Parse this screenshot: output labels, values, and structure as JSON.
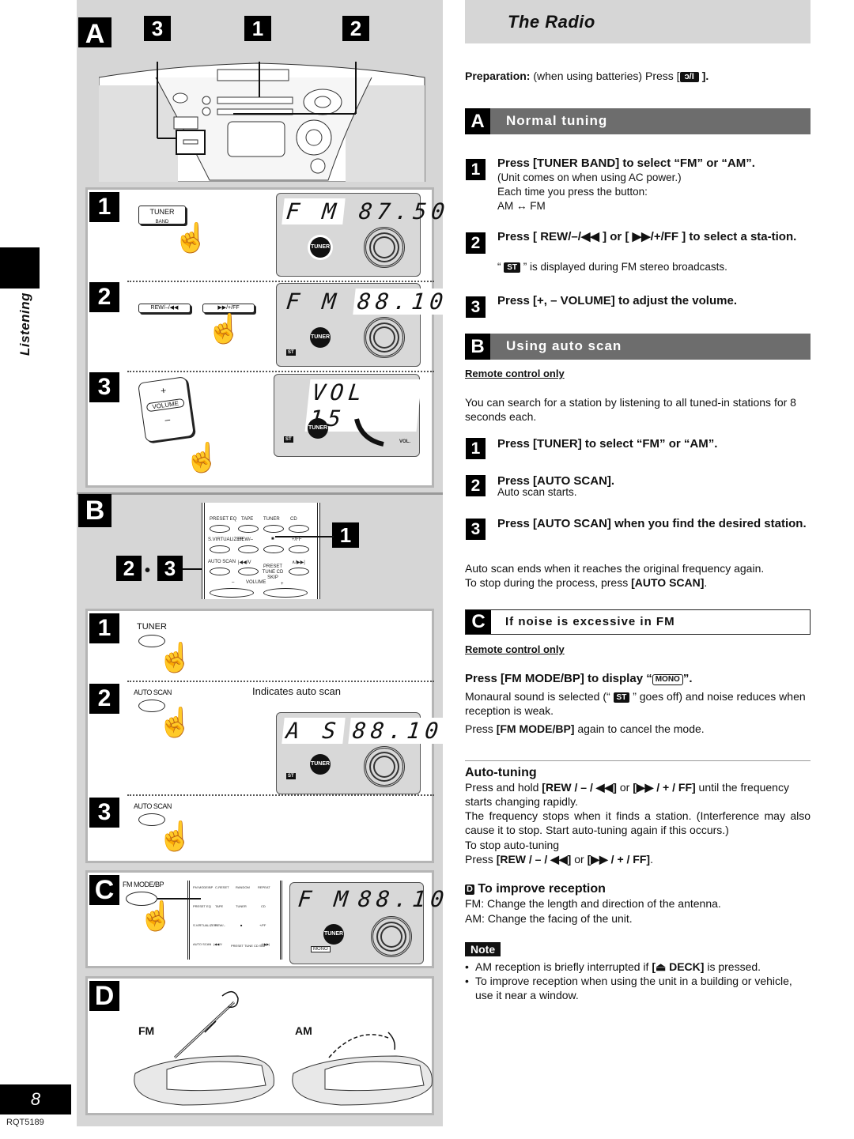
{
  "side_tab": {
    "label": "Listening"
  },
  "footer": {
    "page_number": "8",
    "doc_code": "RQT5189"
  },
  "illustration": {
    "section_a": {
      "letter": "A",
      "callouts": [
        "3",
        "1",
        "2"
      ],
      "steps": [
        {
          "num": "1",
          "button": {
            "label": "TUNER",
            "sublabel": "BAND"
          },
          "display": {
            "band": "F  M",
            "value": "87.50",
            "indicator": "TUNER",
            "st": ""
          }
        },
        {
          "num": "2",
          "buttons": [
            "REW/–/◀◀",
            "▶▶/+/FF"
          ],
          "display": {
            "band": "F  M",
            "value": "88.10",
            "indicator": "TUNER",
            "st": "ST"
          }
        },
        {
          "num": "3",
          "button": {
            "plus": "+",
            "label": "VOLUME",
            "minus": "–"
          },
          "display": {
            "text": "VOL  15",
            "indicator": "TUNER",
            "st": "ST",
            "vol_label": "VOL."
          }
        }
      ]
    },
    "section_b": {
      "letter": "B",
      "callout_right": "1",
      "callout_left": [
        "2",
        "3"
      ],
      "remote_labels": {
        "row1": [
          "PRESET EQ",
          "TAPE",
          "TUNER",
          "CD"
        ],
        "row2": [
          "S.VIRTUALIZER",
          "REW/–",
          "■",
          "+/FF"
        ],
        "row3": [
          "AUTO SCAN",
          "|◀◀/V",
          "PRESET TUNE CD SKIP",
          "∧/▶▶|"
        ],
        "volume": [
          "–",
          "VOLUME",
          "+"
        ]
      },
      "steps": [
        {
          "num": "1",
          "label": "TUNER"
        },
        {
          "num": "2",
          "label": "AUTO SCAN",
          "annotation": "Indicates auto scan",
          "display": {
            "band": "A  S",
            "value": "88.10",
            "indicator": "TUNER",
            "st": "ST"
          }
        },
        {
          "num": "3",
          "label": "AUTO SCAN"
        }
      ]
    },
    "section_c": {
      "letter": "C",
      "button_label": "FM MODE/BP",
      "remote_labels": {
        "row0": [
          "FM MODE/BP",
          "C-RESET",
          "RANDOM",
          "REPEAT"
        ],
        "row1": [
          "PRESET EQ",
          "TAPE",
          "TUNER",
          "CD"
        ],
        "row2": [
          "S.VIRTUALIZER",
          "REW/–",
          "■",
          "+/FF"
        ],
        "row3": [
          "AUTO SCAN",
          "|◀◀/V",
          "PRESET TUNE CD SKIP",
          "∧/▶▶|"
        ]
      },
      "display": {
        "band": "F  M",
        "value": "88.10",
        "indicator": "TUNER",
        "mono": "MONO"
      }
    },
    "section_d": {
      "letter": "D",
      "labels": [
        "FM",
        "AM"
      ]
    }
  },
  "content": {
    "title": "The Radio",
    "preparation": {
      "label": "Preparation:",
      "text": " (when using batteries) Press [",
      "icon": "ↄ/I",
      "end": "]."
    },
    "normal_tuning": {
      "letter": "A",
      "title": "Normal tuning",
      "steps": [
        {
          "num": "1",
          "head": "Press [TUNER BAND] to select “FM” or “AM”.",
          "lines": [
            "(Unit comes on when using AC power.)",
            "Each time you press the button:",
            "AM ↔ FM"
          ]
        },
        {
          "num": "2",
          "head": "Press [ REW/–/◀◀ ] or [ ▶▶/+/FF ] to select a sta-tion.",
          "note_pre": "“ ",
          "note_badge": "ST",
          "note_post": " ” is displayed during FM stereo broadcasts."
        },
        {
          "num": "3",
          "head": "Press [+, – VOLUME] to adjust the volume."
        }
      ]
    },
    "auto_scan": {
      "letter": "B",
      "title": "Using auto scan",
      "remote_only": "Remote control only",
      "intro": "You can search for a station by listening to all tuned-in stations for 8 seconds each.",
      "steps": [
        {
          "num": "1",
          "head": "Press [TUNER] to select “FM” or “AM”."
        },
        {
          "num": "2",
          "head": "Press [AUTO SCAN].",
          "sub": "Auto scan starts."
        },
        {
          "num": "3",
          "head": "Press [AUTO SCAN] when you find the desired station."
        }
      ],
      "outro1": "Auto scan ends when it reaches the original frequency again.",
      "outro2_pre": "To stop during the process, press ",
      "outro2_bold": "[AUTO SCAN]",
      "outro2_post": "."
    },
    "noise": {
      "letter": "C",
      "title": "If noise is excessive in FM",
      "remote_only": "Remote control only",
      "head_pre": "Press [FM MODE/BP] to display “",
      "head_badge": "MONO",
      "head_post": "”.",
      "body_pre": "Monaural sound is selected (“ ",
      "body_badge": "ST",
      "body_post": " ” goes off) and noise reduces when reception is weak.",
      "cancel_pre": "Press ",
      "cancel_bold": "[FM MODE/BP]",
      "cancel_post": " again to cancel the mode."
    },
    "auto_tuning": {
      "title": "Auto-tuning",
      "l1_pre": "Press and hold ",
      "l1_b1": "[REW / – / ◀◀]",
      "l1_mid": " or ",
      "l1_b2": "[▶▶ / + / FF]",
      "l1_post": " until the frequency starts changing rapidly.",
      "l2": "The frequency stops when it finds a station. (Interference may also cause it to stop. Start auto-tuning again if this occurs.)",
      "l3": "To stop auto-tuning",
      "l4_pre": "Press ",
      "l4_b1": "[REW / – / ◀◀]",
      "l4_mid": " or ",
      "l4_b2": "[▶▶ / + / FF]",
      "l4_post": "."
    },
    "reception": {
      "letter": "D",
      "title": "To improve reception",
      "fm": "FM: Change the length and direction of the antenna.",
      "am": "AM: Change the facing of the unit."
    },
    "note": {
      "label": "Note",
      "b1_pre": "AM reception is briefly interrupted if ",
      "b1_bold": "[⏏ DECK]",
      "b1_post": " is pressed.",
      "b2": "To improve reception when using the unit in a building or vehicle, use it near a window."
    }
  }
}
